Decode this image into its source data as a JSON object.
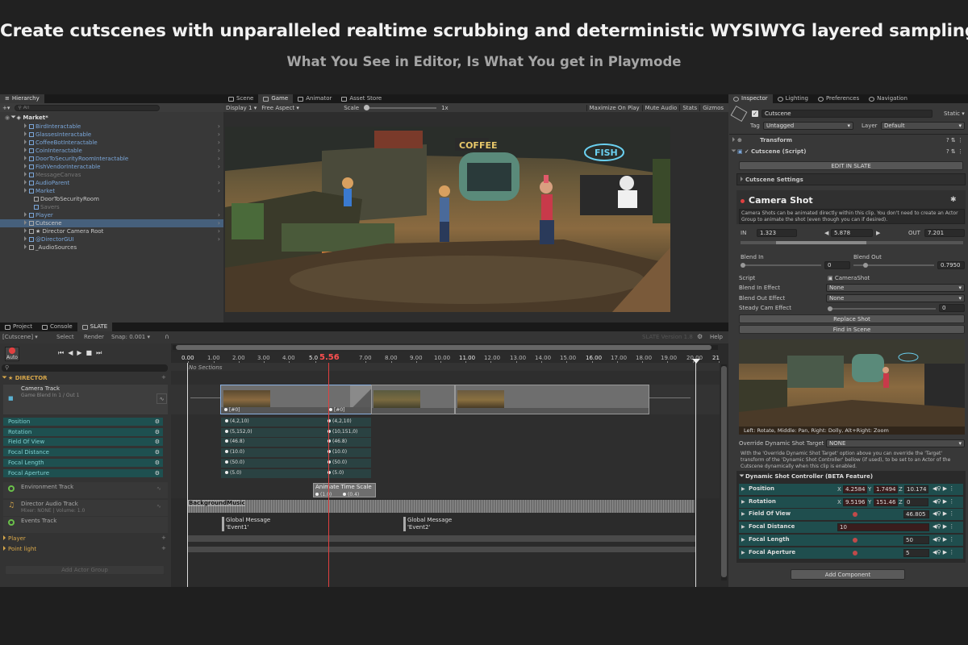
{
  "headline": "Create cutscenes with unparalleled realtime scrubbing and deterministic WYSIWYG layered sampling",
  "subline": "What You See in Editor, Is What You get in Playmode",
  "hierarchy": {
    "tab": "Hierarchy",
    "search_placeholder": "All",
    "scene": "Market*",
    "items": [
      {
        "label": "BirdInteractable",
        "style": "blue"
      },
      {
        "label": "GlassesInteractable",
        "style": "blue"
      },
      {
        "label": "CoffeeBotInteractable",
        "style": "blue"
      },
      {
        "label": "CoinInteractable",
        "style": "blue"
      },
      {
        "label": "DoorToSecurityRoomInteractable",
        "style": "blue"
      },
      {
        "label": "FishVendorInteractable",
        "style": "blue"
      },
      {
        "label": "MessageCanvas",
        "style": "dim"
      },
      {
        "label": "AudioParent",
        "style": "blue"
      },
      {
        "label": "Market",
        "style": "blue"
      },
      {
        "label": "DoorToSecurityRoom",
        "style": "normal"
      },
      {
        "label": "Savers",
        "style": "dim"
      },
      {
        "label": "Player",
        "style": "blue"
      },
      {
        "label": "Cutscene",
        "style": "normal"
      },
      {
        "label": "★ Director Camera Root",
        "style": "normal"
      },
      {
        "label": "@DirectorGUI",
        "style": "blue"
      },
      {
        "label": "_AudioSources",
        "style": "normal"
      }
    ]
  },
  "scene_view": {
    "tabs": [
      "Scene",
      "Game",
      "Animator",
      "Asset Store"
    ],
    "display": "Display 1",
    "aspect": "Free Aspect",
    "scale_label": "Scale",
    "scale_value": "1x",
    "right_buttons": [
      "Maximize On Play",
      "Mute Audio",
      "Stats",
      "Gizmos"
    ]
  },
  "bottom_tabs": [
    "Project",
    "Console",
    "SLATE"
  ],
  "slate": {
    "selector": "[Cutscene]",
    "tools": [
      "Select",
      "Render",
      "Snap: 0.001"
    ],
    "version": "SLATE Version 1.8",
    "help": "Help",
    "auto": "Auto",
    "current_time": "5.56",
    "ruler": [
      "0.00",
      "1.00",
      "2.00",
      "3.00",
      "4.00",
      "5.0",
      "7.00",
      "8.00",
      "9.00",
      "10.00",
      "11.00",
      "12.00",
      "13.00",
      "14.00",
      "15.00",
      "16.00",
      "17.00",
      "18.00",
      "19.00",
      "20.00",
      "21"
    ],
    "sections": "No Sections",
    "director": "★ DIRECTOR",
    "camera_track": "Camera Track",
    "camera_track_sub": "Game Blend In 1 / Out 1",
    "params": [
      "Position",
      "Rotation",
      "Field Of View",
      "Focal Distance",
      "Focal Length",
      "Focal Aperture"
    ],
    "kf_left": [
      "(4,2,10)",
      "(5,152,0)",
      "(46.8)",
      "(10.0)",
      "(50.0)",
      "(5.0)"
    ],
    "kf_right": [
      "(4,2,10)",
      "(10,151,0)",
      "(46.8)",
      "(10.0)",
      "(50.0)",
      "(5.0)"
    ],
    "clip_label_left": "[#0]",
    "clip_label_right": "[#0]",
    "env_track": "Environment Track",
    "time_scale_clip": "Animate Time Scale",
    "time_scale_vals": [
      "(1.0)",
      "(0.4)"
    ],
    "audio_track": "Director Audio Track",
    "audio_sub": "Mixer: NONE | Volume: 1.0",
    "audio_clip": "BackgroundMusic",
    "events_track": "Events Track",
    "events": [
      {
        "title": "Global Message",
        "name": "'Event1'"
      },
      {
        "title": "Global Message",
        "name": "'Event2'"
      }
    ],
    "groups": [
      "Player",
      "Point light"
    ],
    "add_actor": "Add Actor Group"
  },
  "inspector": {
    "tabs": [
      "Inspector",
      "Lighting",
      "Preferences",
      "Navigation"
    ],
    "object_name": "Cutscene",
    "static": "Static",
    "tag_label": "Tag",
    "tag": "Untagged",
    "layer_label": "Layer",
    "layer": "Default",
    "transform": "Transform",
    "script": "Cutscene (Script)",
    "edit_button": "EDIT IN SLATE",
    "settings": "Cutscene Settings",
    "shot_title": "Camera Shot",
    "shot_help": "Camera Shots can be animated directly within this clip. You don't need to create an Actor Group to animate the shot (even though you can if desired).",
    "in_label": "IN",
    "in_val": "1.323",
    "len_val": "5.878",
    "out_label": "OUT",
    "out_val": "7.201",
    "blend_in_label": "Blend In",
    "blend_in": "0",
    "blend_out_label": "Blend Out",
    "blend_out": "0.7950",
    "script_label": "Script",
    "script_val": "CameraShot",
    "blend_in_effect_label": "Blend In Effect",
    "blend_in_effect": "None",
    "blend_out_effect_label": "Blend Out Effect",
    "blend_out_effect": "None",
    "steady_label": "Steady Cam Effect",
    "steady_val": "0",
    "replace_btn": "Replace Shot",
    "find_btn": "Find in Scene",
    "preview_hint": "Left: Rotate, Middle: Pan, Right: Dolly, Alt+Right: Zoom",
    "override_label": "Override Dynamic Shot Target",
    "override_val": "NONE",
    "override_help": "With the 'Override Dynamic Shot Target' option above you can override the 'Target' transform of the 'Dynamic Shot Controller' bellow (if used), to be set to an Actor of the Cutscene dynamically when this clip is enabled.",
    "dsc_title": "Dynamic Shot Controller (BETA Feature)",
    "position_label": "Position",
    "pos": [
      "4.2584",
      "1.7494",
      "10.174"
    ],
    "rotation_label": "Rotation",
    "rot": [
      "9.5196",
      "151.46",
      "0"
    ],
    "fov_label": "Field Of View",
    "fov": "46.805",
    "fdist_label": "Focal Distance",
    "fdist": "10",
    "flen_label": "Focal Length",
    "flen": "50",
    "fap_label": "Focal Aperture",
    "fap": "5",
    "add_component": "Add Component"
  }
}
